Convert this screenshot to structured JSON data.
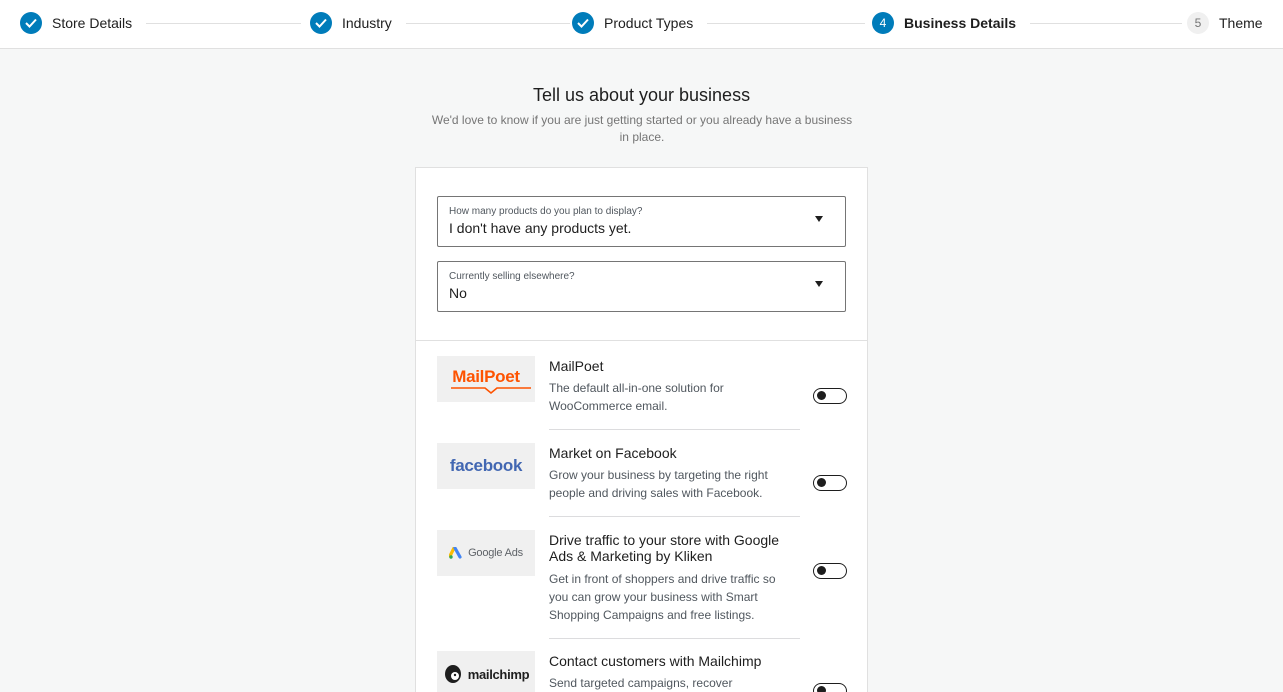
{
  "stepper": {
    "steps": [
      {
        "number": "1",
        "label": "Store Details",
        "state": "done"
      },
      {
        "number": "2",
        "label": "Industry",
        "state": "done"
      },
      {
        "number": "3",
        "label": "Product Types",
        "state": "done"
      },
      {
        "number": "4",
        "label": "Business Details",
        "state": "current"
      },
      {
        "number": "5",
        "label": "Theme",
        "state": "todo"
      }
    ]
  },
  "header": {
    "title": "Tell us about your business",
    "subtitle": "We'd love to know if you are just getting started or you already have a business in place."
  },
  "form": {
    "product_count": {
      "label": "How many products do you plan to display?",
      "value": "I don't have any products yet."
    },
    "selling_elsewhere": {
      "label": "Currently selling elsewhere?",
      "value": "No"
    }
  },
  "extensions": [
    {
      "logo_text": "MailPoet",
      "title": "MailPoet",
      "description": "The default all-in-one solution for WooCommerce email.",
      "enabled": false
    },
    {
      "logo_text": "facebook",
      "title": "Market on Facebook",
      "description": "Grow your business by targeting the right people and driving sales with Facebook.",
      "enabled": false
    },
    {
      "logo_text": "Google Ads",
      "title": "Drive traffic to your store with Google Ads & Marketing by Kliken",
      "description": "Get in front of shoppers and drive traffic so you can grow your business with Smart Shopping Campaigns and free listings.",
      "enabled": false
    },
    {
      "logo_text": "mailchimp",
      "title": "Contact customers with Mailchimp",
      "description": "Send targeted campaigns, recover",
      "enabled": false
    }
  ],
  "colors": {
    "accent": "#007cba",
    "mailpoet": "#fe5301",
    "facebook": "#4267b2",
    "background": "#f6f7f7"
  }
}
